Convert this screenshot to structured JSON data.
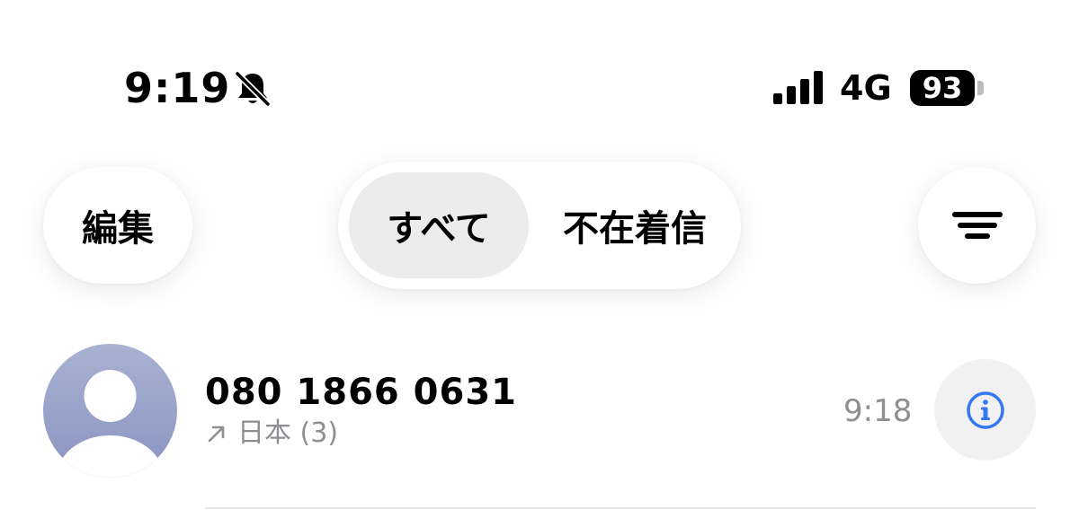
{
  "status_bar": {
    "time": "9:19",
    "network": "4G",
    "battery": "93",
    "icons": [
      "bell-slash-icon",
      "signal-bars-icon",
      "battery-icon"
    ]
  },
  "toolbar": {
    "edit_label": "編集",
    "segments": [
      {
        "label": "すべて",
        "selected": true
      },
      {
        "label": "不在着信",
        "selected": false
      }
    ],
    "filter_icon": "filter-lines-icon"
  },
  "calls": [
    {
      "number": "080 1866 0631",
      "direction_icon": "outgoing-arrow-icon",
      "location": "日本 (3)",
      "time": "9:18",
      "info_icon": "info-icon"
    }
  ],
  "colors": {
    "accent_blue": "#3478f6",
    "secondary_text": "#8e8e93",
    "selected_segment": "#ececec",
    "avatar_top": "#a9b2d3",
    "avatar_bottom": "#8a93bf"
  }
}
